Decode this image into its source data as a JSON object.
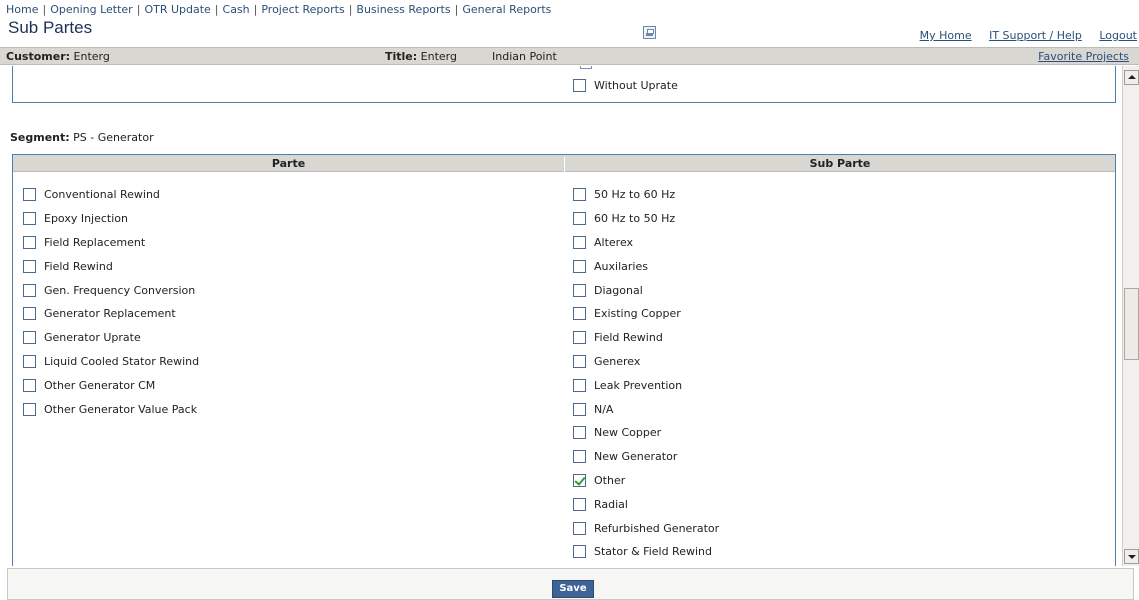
{
  "topnav": {
    "items": [
      "Home",
      "Opening Letter",
      "OTR Update",
      "Cash",
      "Project Reports",
      "Business Reports",
      "General Reports"
    ]
  },
  "page": {
    "title": "Sub Partes"
  },
  "header_links": {
    "my_home": "My Home",
    "it_support": "IT Support / Help",
    "logout": "Logout"
  },
  "infobar": {
    "customer_label": "Customer:",
    "customer_value": "Enterg",
    "title_label": "Title:",
    "title_value": "Enterg",
    "project_value": "Indian Point",
    "favorite_projects": "Favorite Projects"
  },
  "prev_panel": {
    "item_label": "Without Uprate",
    "checked": false
  },
  "segment": {
    "label": "Segment:",
    "value": "PS - Generator"
  },
  "table": {
    "col_parte": "Parte",
    "col_sub_parte": "Sub Parte",
    "partes": [
      {
        "label": "Conventional Rewind",
        "checked": false
      },
      {
        "label": "Epoxy Injection",
        "checked": false
      },
      {
        "label": "Field Replacement",
        "checked": false
      },
      {
        "label": "Field Rewind",
        "checked": false
      },
      {
        "label": "Gen. Frequency Conversion",
        "checked": false
      },
      {
        "label": "Generator Replacement",
        "checked": false
      },
      {
        "label": "Generator Uprate",
        "checked": false
      },
      {
        "label": "Liquid Cooled Stator Rewind",
        "checked": false
      },
      {
        "label": "Other Generator CM",
        "checked": false
      },
      {
        "label": "Other Generator Value Pack",
        "checked": false
      }
    ],
    "sub_partes": [
      {
        "label": "50 Hz to 60 Hz",
        "checked": false
      },
      {
        "label": "60 Hz to 50 Hz",
        "checked": false
      },
      {
        "label": "Alterex",
        "checked": false
      },
      {
        "label": "Auxilaries",
        "checked": false
      },
      {
        "label": "Diagonal",
        "checked": false
      },
      {
        "label": "Existing Copper",
        "checked": false
      },
      {
        "label": "Field Rewind",
        "checked": false
      },
      {
        "label": "Generex",
        "checked": false
      },
      {
        "label": "Leak Prevention",
        "checked": false
      },
      {
        "label": "N/A",
        "checked": false
      },
      {
        "label": "New Copper",
        "checked": false
      },
      {
        "label": "New Generator",
        "checked": false
      },
      {
        "label": "Other",
        "checked": true
      },
      {
        "label": "Radial",
        "checked": false
      },
      {
        "label": "Refurbished Generator",
        "checked": false
      },
      {
        "label": "Stator & Field Rewind",
        "checked": false
      }
    ]
  },
  "footer": {
    "save_label": "Save"
  },
  "icons": {
    "print": "print-icon"
  }
}
